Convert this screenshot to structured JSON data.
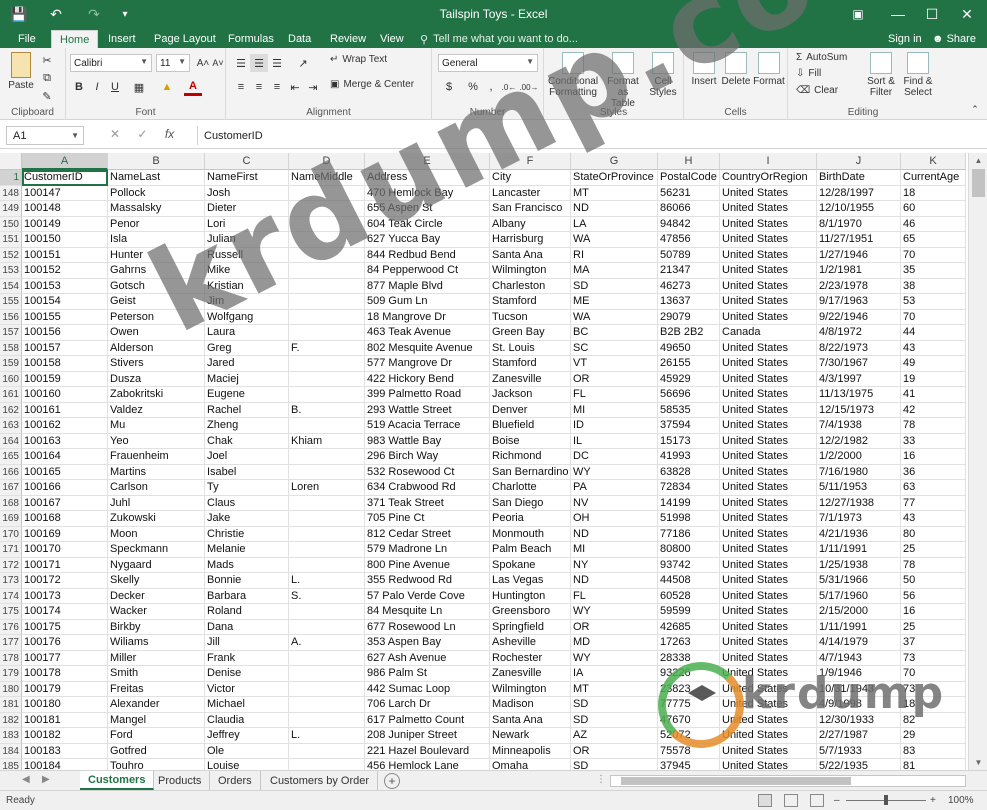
{
  "window": {
    "title": "Tailspin Toys - Excel"
  },
  "tabs": [
    "File",
    "Home",
    "Insert",
    "Page Layout",
    "Formulas",
    "Data",
    "Review",
    "View"
  ],
  "tell_me": "Tell me what you want to do...",
  "signin": "Sign in",
  "share": "Share",
  "ribbon": {
    "clipboard": {
      "paste": "Paste",
      "label": "Clipboard"
    },
    "font": {
      "name": "Calibri",
      "size": "11",
      "label": "Font",
      "bold": "B",
      "italic": "I",
      "underline": "U"
    },
    "alignment": {
      "wrap": "Wrap Text",
      "merge": "Merge & Center",
      "label": "Alignment"
    },
    "number": {
      "format": "General",
      "currency": "$",
      "percent": "%",
      "comma": ",",
      "label": "Number"
    },
    "styles": {
      "conditional": [
        "Conditional",
        "Formatting"
      ],
      "table": [
        "Format as",
        "Table"
      ],
      "cell": [
        "Cell",
        "Styles"
      ],
      "label": "Styles"
    },
    "cells": {
      "insert": "Insert",
      "delete": "Delete",
      "format": "Format",
      "label": "Cells"
    },
    "editing": {
      "autosum": "AutoSum",
      "fill": "Fill",
      "clear": "Clear",
      "sort": [
        "Sort &",
        "Filter"
      ],
      "find": [
        "Find &",
        "Select"
      ],
      "label": "Editing"
    }
  },
  "formula_bar": {
    "name_box": "A1",
    "fx": "fx",
    "content": "CustomerID"
  },
  "columns": [
    "A",
    "B",
    "C",
    "D",
    "E",
    "F",
    "G",
    "H",
    "I",
    "J",
    "K"
  ],
  "header_row": {
    "row": "1",
    "cells": [
      "CustomerID",
      "NameLast",
      "NameFirst",
      "NameMiddle",
      "Address",
      "City",
      "StateOrProvince",
      "PostalCode",
      "CountryOrRegion",
      "BirthDate",
      "CurrentAge"
    ]
  },
  "rows": [
    {
      "row": "148",
      "cells": [
        "100147",
        "Pollock",
        "Josh",
        "",
        "470 Hemlock Bay",
        "Lancaster",
        "MT",
        "56231",
        "United States",
        "12/28/1997",
        "18"
      ]
    },
    {
      "row": "149",
      "cells": [
        "100148",
        "Massalsky",
        "Dieter",
        "",
        "655 Aspen St",
        "San Francisco",
        "ND",
        "86066",
        "United States",
        "12/10/1955",
        "60"
      ]
    },
    {
      "row": "150",
      "cells": [
        "100149",
        "Penor",
        "Lori",
        "",
        "604 Teak Circle",
        "Albany",
        "LA",
        "94842",
        "United States",
        "8/1/1970",
        "46"
      ]
    },
    {
      "row": "151",
      "cells": [
        "100150",
        "Isla",
        "Julian",
        "",
        "627 Yucca Bay",
        "Harrisburg",
        "WA",
        "47856",
        "United States",
        "11/27/1951",
        "65"
      ]
    },
    {
      "row": "152",
      "cells": [
        "100151",
        "Hunter",
        "Russell",
        "",
        "844 Redbud Bend",
        "Santa Ana",
        "RI",
        "50789",
        "United States",
        "1/27/1946",
        "70"
      ]
    },
    {
      "row": "153",
      "cells": [
        "100152",
        "Gahrns",
        "Mike",
        "",
        "84 Pepperwood Ct",
        "Wilmington",
        "MA",
        "21347",
        "United States",
        "1/2/1981",
        "35"
      ]
    },
    {
      "row": "154",
      "cells": [
        "100153",
        "Gotsch",
        "Kristian",
        "",
        "877 Maple Blvd",
        "Charleston",
        "SD",
        "46273",
        "United States",
        "2/23/1978",
        "38"
      ]
    },
    {
      "row": "155",
      "cells": [
        "100154",
        "Geist",
        "Jim",
        "",
        "509 Gum Ln",
        "Stamford",
        "ME",
        "13637",
        "United States",
        "9/17/1963",
        "53"
      ]
    },
    {
      "row": "156",
      "cells": [
        "100155",
        "Peterson",
        "Wolfgang",
        "",
        "18 Mangrove Dr",
        "Tucson",
        "WA",
        "29079",
        "United States",
        "9/22/1946",
        "70"
      ]
    },
    {
      "row": "157",
      "cells": [
        "100156",
        "Owen",
        "Laura",
        "",
        "463 Teak Avenue",
        "Green Bay",
        "BC",
        "B2B 2B2",
        "Canada",
        "4/8/1972",
        "44"
      ]
    },
    {
      "row": "158",
      "cells": [
        "100157",
        "Alderson",
        "Greg",
        "F.",
        "802 Mesquite Avenue",
        "St. Louis",
        "SC",
        "49650",
        "United States",
        "8/22/1973",
        "43"
      ]
    },
    {
      "row": "159",
      "cells": [
        "100158",
        "Stivers",
        "Jared",
        "",
        "577 Mangrove Dr",
        "Stamford",
        "VT",
        "26155",
        "United States",
        "7/30/1967",
        "49"
      ]
    },
    {
      "row": "160",
      "cells": [
        "100159",
        "Dusza",
        "Maciej",
        "",
        "422 Hickory Bend",
        "Zanesville",
        "OR",
        "45929",
        "United States",
        "4/3/1997",
        "19"
      ]
    },
    {
      "row": "161",
      "cells": [
        "100160",
        "Zabokritski",
        "Eugene",
        "",
        "399 Palmetto Road",
        "Jackson",
        "FL",
        "56696",
        "United States",
        "11/13/1975",
        "41"
      ]
    },
    {
      "row": "162",
      "cells": [
        "100161",
        "Valdez",
        "Rachel",
        "B.",
        "293 Wattle Street",
        "Denver",
        "MI",
        "58535",
        "United States",
        "12/15/1973",
        "42"
      ]
    },
    {
      "row": "163",
      "cells": [
        "100162",
        "Mu",
        "Zheng",
        "",
        "519 Acacia Terrace",
        "Bluefield",
        "ID",
        "37594",
        "United States",
        "7/4/1938",
        "78"
      ]
    },
    {
      "row": "164",
      "cells": [
        "100163",
        "Yeo",
        "Chak",
        "Khiam",
        "983 Wattle Bay",
        "Boise",
        "IL",
        "15173",
        "United States",
        "12/2/1982",
        "33"
      ]
    },
    {
      "row": "165",
      "cells": [
        "100164",
        "Frauenheim",
        "Joel",
        "",
        "296 Birch Way",
        "Richmond",
        "DC",
        "41993",
        "United States",
        "1/2/2000",
        "16"
      ]
    },
    {
      "row": "166",
      "cells": [
        "100165",
        "Martins",
        "Isabel",
        "",
        "532 Rosewood Ct",
        "San Bernardino",
        "WY",
        "63828",
        "United States",
        "7/16/1980",
        "36"
      ]
    },
    {
      "row": "167",
      "cells": [
        "100166",
        "Carlson",
        "Ty",
        "Loren",
        "634 Crabwood Rd",
        "Charlotte",
        "PA",
        "72834",
        "United States",
        "5/11/1953",
        "63"
      ]
    },
    {
      "row": "168",
      "cells": [
        "100167",
        "Juhl",
        "Claus",
        "",
        "371 Teak Street",
        "San Diego",
        "NV",
        "14199",
        "United States",
        "12/27/1938",
        "77"
      ]
    },
    {
      "row": "169",
      "cells": [
        "100168",
        "Zukowski",
        "Jake",
        "",
        "705 Pine Ct",
        "Peoria",
        "OH",
        "51998",
        "United States",
        "7/1/1973",
        "43"
      ]
    },
    {
      "row": "170",
      "cells": [
        "100169",
        "Moon",
        "Christie",
        "",
        "812 Cedar Street",
        "Monmouth",
        "ND",
        "77186",
        "United States",
        "4/21/1936",
        "80"
      ]
    },
    {
      "row": "171",
      "cells": [
        "100170",
        "Speckmann",
        "Melanie",
        "",
        "579 Madrone Ln",
        "Palm Beach",
        "MI",
        "80800",
        "United States",
        "1/11/1991",
        "25"
      ]
    },
    {
      "row": "172",
      "cells": [
        "100171",
        "Nygaard",
        "Mads",
        "",
        "800 Pine Avenue",
        "Spokane",
        "NY",
        "93742",
        "United States",
        "1/25/1938",
        "78"
      ]
    },
    {
      "row": "173",
      "cells": [
        "100172",
        "Skelly",
        "Bonnie",
        "L.",
        "355 Redwood Rd",
        "Las Vegas",
        "ND",
        "44508",
        "United States",
        "5/31/1966",
        "50"
      ]
    },
    {
      "row": "174",
      "cells": [
        "100173",
        "Decker",
        "Barbara",
        "S.",
        "57 Palo Verde Cove",
        "Huntington",
        "FL",
        "60528",
        "United States",
        "5/17/1960",
        "56"
      ]
    },
    {
      "row": "175",
      "cells": [
        "100174",
        "Wacker",
        "Roland",
        "",
        "84 Mesquite Ln",
        "Greensboro",
        "WY",
        "59599",
        "United States",
        "2/15/2000",
        "16"
      ]
    },
    {
      "row": "176",
      "cells": [
        "100175",
        "Birkby",
        "Dana",
        "",
        "677 Rosewood Ln",
        "Springfield",
        "OR",
        "42685",
        "United States",
        "1/11/1991",
        "25"
      ]
    },
    {
      "row": "177",
      "cells": [
        "100176",
        "Wiliams",
        "Jill",
        "A.",
        "353 Aspen Bay",
        "Asheville",
        "MD",
        "17263",
        "United States",
        "4/14/1979",
        "37"
      ]
    },
    {
      "row": "178",
      "cells": [
        "100177",
        "Miller",
        "Frank",
        "",
        "627 Ash Avenue",
        "Rochester",
        "WY",
        "28338",
        "United States",
        "4/7/1943",
        "73"
      ]
    },
    {
      "row": "179",
      "cells": [
        "100178",
        "Smith",
        "Denise",
        "",
        "986 Palm St",
        "Zanesville",
        "IA",
        "93226",
        "United States",
        "1/9/1946",
        "70"
      ]
    },
    {
      "row": "180",
      "cells": [
        "100179",
        "Freitas",
        "Victor",
        "",
        "442 Sumac Loop",
        "Wilmington",
        "MT",
        "23823",
        "United States",
        "10/31/1943",
        "73"
      ]
    },
    {
      "row": "181",
      "cells": [
        "100180",
        "Alexander",
        "Michael",
        "",
        "706 Larch Dr",
        "Madison",
        "SD",
        "77775",
        "United States",
        "4/9/1998",
        "18"
      ]
    },
    {
      "row": "182",
      "cells": [
        "100181",
        "Mangel",
        "Claudia",
        "",
        "617 Palmetto Count",
        "Santa Ana",
        "SD",
        "47670",
        "United States",
        "12/30/1933",
        "82"
      ]
    },
    {
      "row": "183",
      "cells": [
        "100182",
        "Ford",
        "Jeffrey",
        "L.",
        "208 Juniper Street",
        "Newark",
        "AZ",
        "52072",
        "United States",
        "2/27/1987",
        "29"
      ]
    },
    {
      "row": "184",
      "cells": [
        "100183",
        "Gotfred",
        "Ole",
        "",
        "221 Hazel Boulevard",
        "Minneapolis",
        "OR",
        "75578",
        "United States",
        "5/7/1933",
        "83"
      ]
    },
    {
      "row": "185",
      "cells": [
        "100184",
        "Touhro",
        "Louise",
        "",
        "456 Hemlock Lane",
        "Omaha",
        "SD",
        "37945",
        "United States",
        "5/22/1935",
        "81"
      ]
    }
  ],
  "sheets": [
    "Customers",
    "Products",
    "Orders",
    "Customers by Order"
  ],
  "active_sheet": "Customers",
  "status": {
    "ready": "Ready",
    "zoom": "100%"
  },
  "watermarks": {
    "main": "krdump.com",
    "logo": "krdump"
  },
  "colors": {
    "accent": "#217346"
  }
}
